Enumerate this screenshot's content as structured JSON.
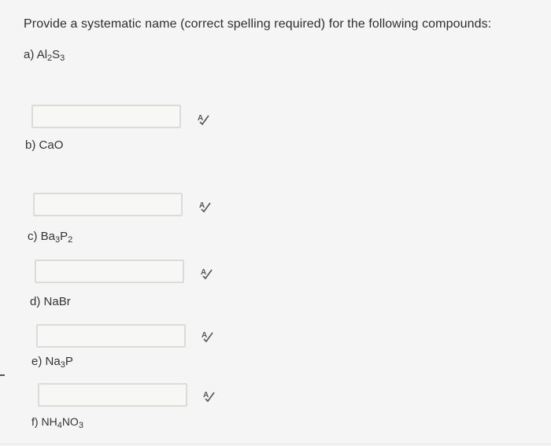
{
  "question": "Provide a systematic name (correct spelling required) for the following compounds:",
  "parts": [
    {
      "prefix": "a) ",
      "segments": [
        {
          "t": "Al"
        },
        {
          "t": "2",
          "sub": true
        },
        {
          "t": "S"
        },
        {
          "t": "3",
          "sub": true
        }
      ],
      "answer": ""
    },
    {
      "prefix": "b) ",
      "segments": [
        {
          "t": "CaO"
        }
      ],
      "answer": ""
    },
    {
      "prefix": "c) ",
      "segments": [
        {
          "t": "Ba"
        },
        {
          "t": "3",
          "sub": true
        },
        {
          "t": "P"
        },
        {
          "t": "2",
          "sub": true
        }
      ],
      "answer": ""
    },
    {
      "prefix": "d) ",
      "segments": [
        {
          "t": "NaBr"
        }
      ],
      "answer": ""
    },
    {
      "prefix": "e) ",
      "segments": [
        {
          "t": "Na"
        },
        {
          "t": "3",
          "sub": true
        },
        {
          "t": "P"
        }
      ],
      "answer": ""
    },
    {
      "prefix": "f) ",
      "segments": [
        {
          "t": "NH"
        },
        {
          "t": "4",
          "sub": true
        },
        {
          "t": "NO"
        },
        {
          "t": "3",
          "sub": true
        }
      ],
      "answer": ""
    }
  ],
  "spell_check_icon": "spell-check-icon",
  "colors": {
    "background": "#f4f5f4",
    "box_border": "#d9dcd8",
    "text": "#2e2e2e"
  }
}
